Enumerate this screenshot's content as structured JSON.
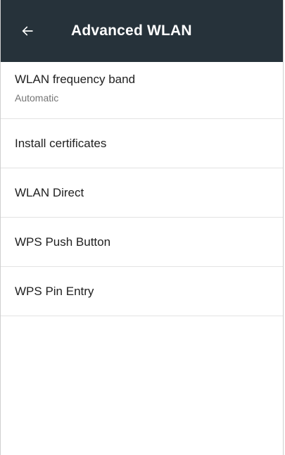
{
  "toolbar": {
    "title": "Advanced WLAN",
    "back_icon": "arrow-left-icon",
    "background_color": "#26323a"
  },
  "settings": {
    "items": [
      {
        "title": "WLAN frequency band",
        "summary": "Automatic"
      },
      {
        "title": "Install certificates"
      },
      {
        "title": "WLAN Direct"
      },
      {
        "title": "WPS Push Button"
      },
      {
        "title": "WPS Pin Entry"
      }
    ]
  }
}
